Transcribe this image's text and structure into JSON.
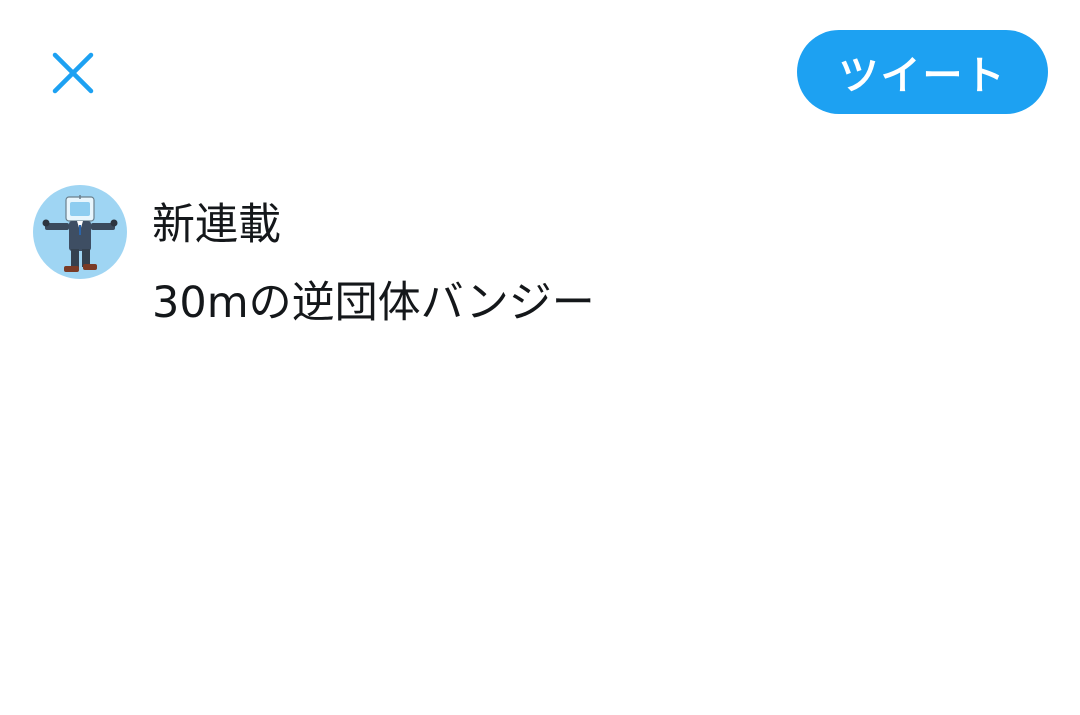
{
  "header": {
    "close_icon": "close-icon",
    "tweet_button_label": "ツイート"
  },
  "composer": {
    "avatar_icon": "user-avatar",
    "lines": [
      "新連載",
      "30mの逆団体バンジー"
    ]
  },
  "colors": {
    "accent": "#1da1f2",
    "text": "#14171a",
    "avatar_bg": "#9fd5f3"
  }
}
